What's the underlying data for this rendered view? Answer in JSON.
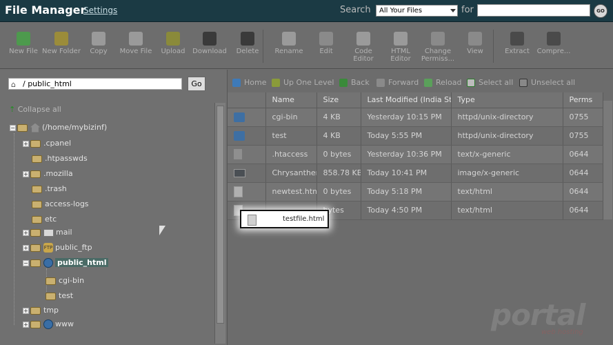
{
  "header": {
    "title": "File Manager",
    "settings_link": "Settings",
    "search_label": "Search",
    "search_scope": "All Your Files",
    "for_label": "for",
    "search_value": "",
    "go_label": "GO"
  },
  "toolbar": [
    {
      "label": "New File",
      "icon": "new-file-icon",
      "color": "#4d9a4d"
    },
    {
      "label": "New Folder",
      "icon": "new-folder-icon",
      "color": "#9b8c3a"
    },
    {
      "label": "Copy",
      "icon": "copy-icon",
      "color": "#9a9a9a"
    },
    {
      "label": "Move File",
      "icon": "move-file-icon",
      "color": "#9a9a9a"
    },
    {
      "label": "Upload",
      "icon": "upload-icon",
      "color": "#8a8a3a"
    },
    {
      "label": "Download",
      "icon": "download-icon",
      "color": "#3a3a3a"
    },
    {
      "label": "Delete",
      "icon": "delete-icon",
      "color": "#3a3a3a"
    },
    {
      "label": "Rename",
      "icon": "rename-icon",
      "color": "#9a9a9a"
    },
    {
      "label": "Edit",
      "icon": "edit-icon",
      "color": "#8a8a8a"
    },
    {
      "label": "Code Editor",
      "icon": "code-editor-icon",
      "color": "#9a9a9a"
    },
    {
      "label": "HTML Editor",
      "icon": "html-editor-icon",
      "color": "#9a9a9a"
    },
    {
      "label": "Change Permiss...",
      "icon": "change-permissions-icon",
      "color": "#8a8a8a"
    },
    {
      "label": "View",
      "icon": "view-icon",
      "color": "#8a8a8a"
    },
    {
      "label": "Extract",
      "icon": "extract-icon",
      "color": "#4a4a4a"
    },
    {
      "label": "Compre...",
      "icon": "compress-icon",
      "color": "#4a4a4a"
    }
  ],
  "left": {
    "path_value": "/ public_html",
    "go_label": "Go",
    "collapse_all": "Collapse all",
    "tree": {
      "root": "(/home/mybizinf)",
      "items": [
        ".cpanel",
        ".htpasswds",
        ".mozilla",
        ".trash",
        "access-logs",
        "etc",
        "mail",
        "public_ftp",
        "public_html",
        "cgi-bin",
        "test",
        "tmp",
        "www"
      ]
    }
  },
  "nav": {
    "home": "Home",
    "up": "Up One Level",
    "back": "Back",
    "forward": "Forward",
    "reload": "Reload",
    "select_all": "Select all",
    "unselect_all": "Unselect all"
  },
  "table": {
    "columns": [
      "Name",
      "Size",
      "Last Modified (India Stand",
      "Type",
      "Perms"
    ],
    "rows": [
      {
        "icon": "folder",
        "name": "cgi-bin",
        "size": "4 KB",
        "modified": "Yesterday 10:15 PM",
        "type": "httpd/unix-directory",
        "perms": "0755"
      },
      {
        "icon": "folder",
        "name": "test",
        "size": "4 KB",
        "modified": "Today 5:55 PM",
        "type": "httpd/unix-directory",
        "perms": "0755"
      },
      {
        "icon": "text",
        "name": ".htaccess",
        "size": "0 bytes",
        "modified": "Yesterday 10:36 PM",
        "type": "text/x-generic",
        "perms": "0644"
      },
      {
        "icon": "image",
        "name": "Chrysanthem",
        "size": "858.78 KB",
        "modified": "Today 10:41 PM",
        "type": "image/x-generic",
        "perms": "0644"
      },
      {
        "icon": "html",
        "name": "newtest.html",
        "size": "0 bytes",
        "modified": "Today 5:18 PM",
        "type": "text/html",
        "perms": "0644"
      },
      {
        "icon": "html",
        "name": "",
        "size": "bytes",
        "modified": "Today 4:50 PM",
        "type": "text/html",
        "perms": "0644"
      }
    ]
  },
  "drag_item": {
    "name": "testfile.html"
  },
  "watermark": {
    "text": "portal",
    "sub": "web hosting"
  }
}
